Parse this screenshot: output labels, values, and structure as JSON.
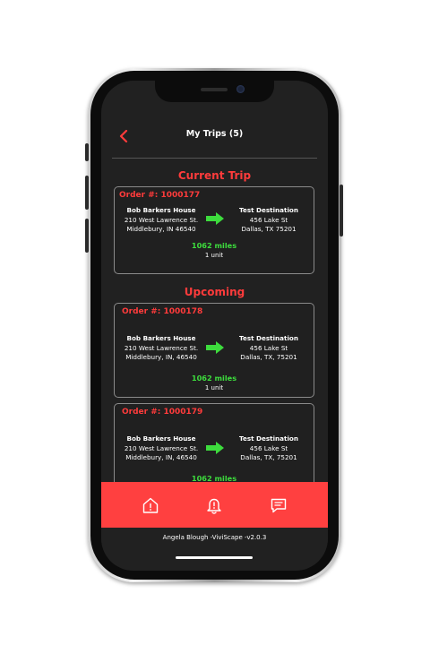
{
  "header": {
    "title": "My Trips (5)"
  },
  "sections": {
    "current": "Current Trip",
    "upcoming": "Upcoming"
  },
  "trips": [
    {
      "order": "Order #: 1000177",
      "origin": {
        "name": "Bob Barkers House",
        "street": "210 West Lawrence St.",
        "city": "Middlebury, IN 46540"
      },
      "destination": {
        "name": "Test Destination",
        "street": "456 Lake St",
        "city": "Dallas, TX 75201"
      },
      "miles": "1062 miles",
      "units": "1 unit"
    },
    {
      "order": "Order #: 1000178",
      "origin": {
        "name": "Bob Barkers House",
        "street": "210 West Lawrence St.",
        "city": "Middlebury, IN, 46540"
      },
      "destination": {
        "name": "Test Destination",
        "street": "456 Lake St",
        "city": "Dallas, TX, 75201"
      },
      "miles": "1062 miles",
      "units": "1 unit"
    },
    {
      "order": "Order #: 1000179",
      "origin": {
        "name": "Bob Barkers House",
        "street": "210 West Lawrence St.",
        "city": "Middlebury, IN, 46540"
      },
      "destination": {
        "name": "Test Destination",
        "street": "456 Lake St",
        "city": "Dallas, TX, 75201"
      },
      "miles": "1062 miles"
    }
  ],
  "nav": {
    "icons": [
      "home-alert-icon",
      "bell-alert-icon",
      "message-alert-icon"
    ]
  },
  "footer": {
    "text": "Angela Blough  -ViviScape  -v2.0.3"
  },
  "colors": {
    "accent": "#ff4040",
    "miles": "#3ddc3d",
    "background": "#212121"
  }
}
